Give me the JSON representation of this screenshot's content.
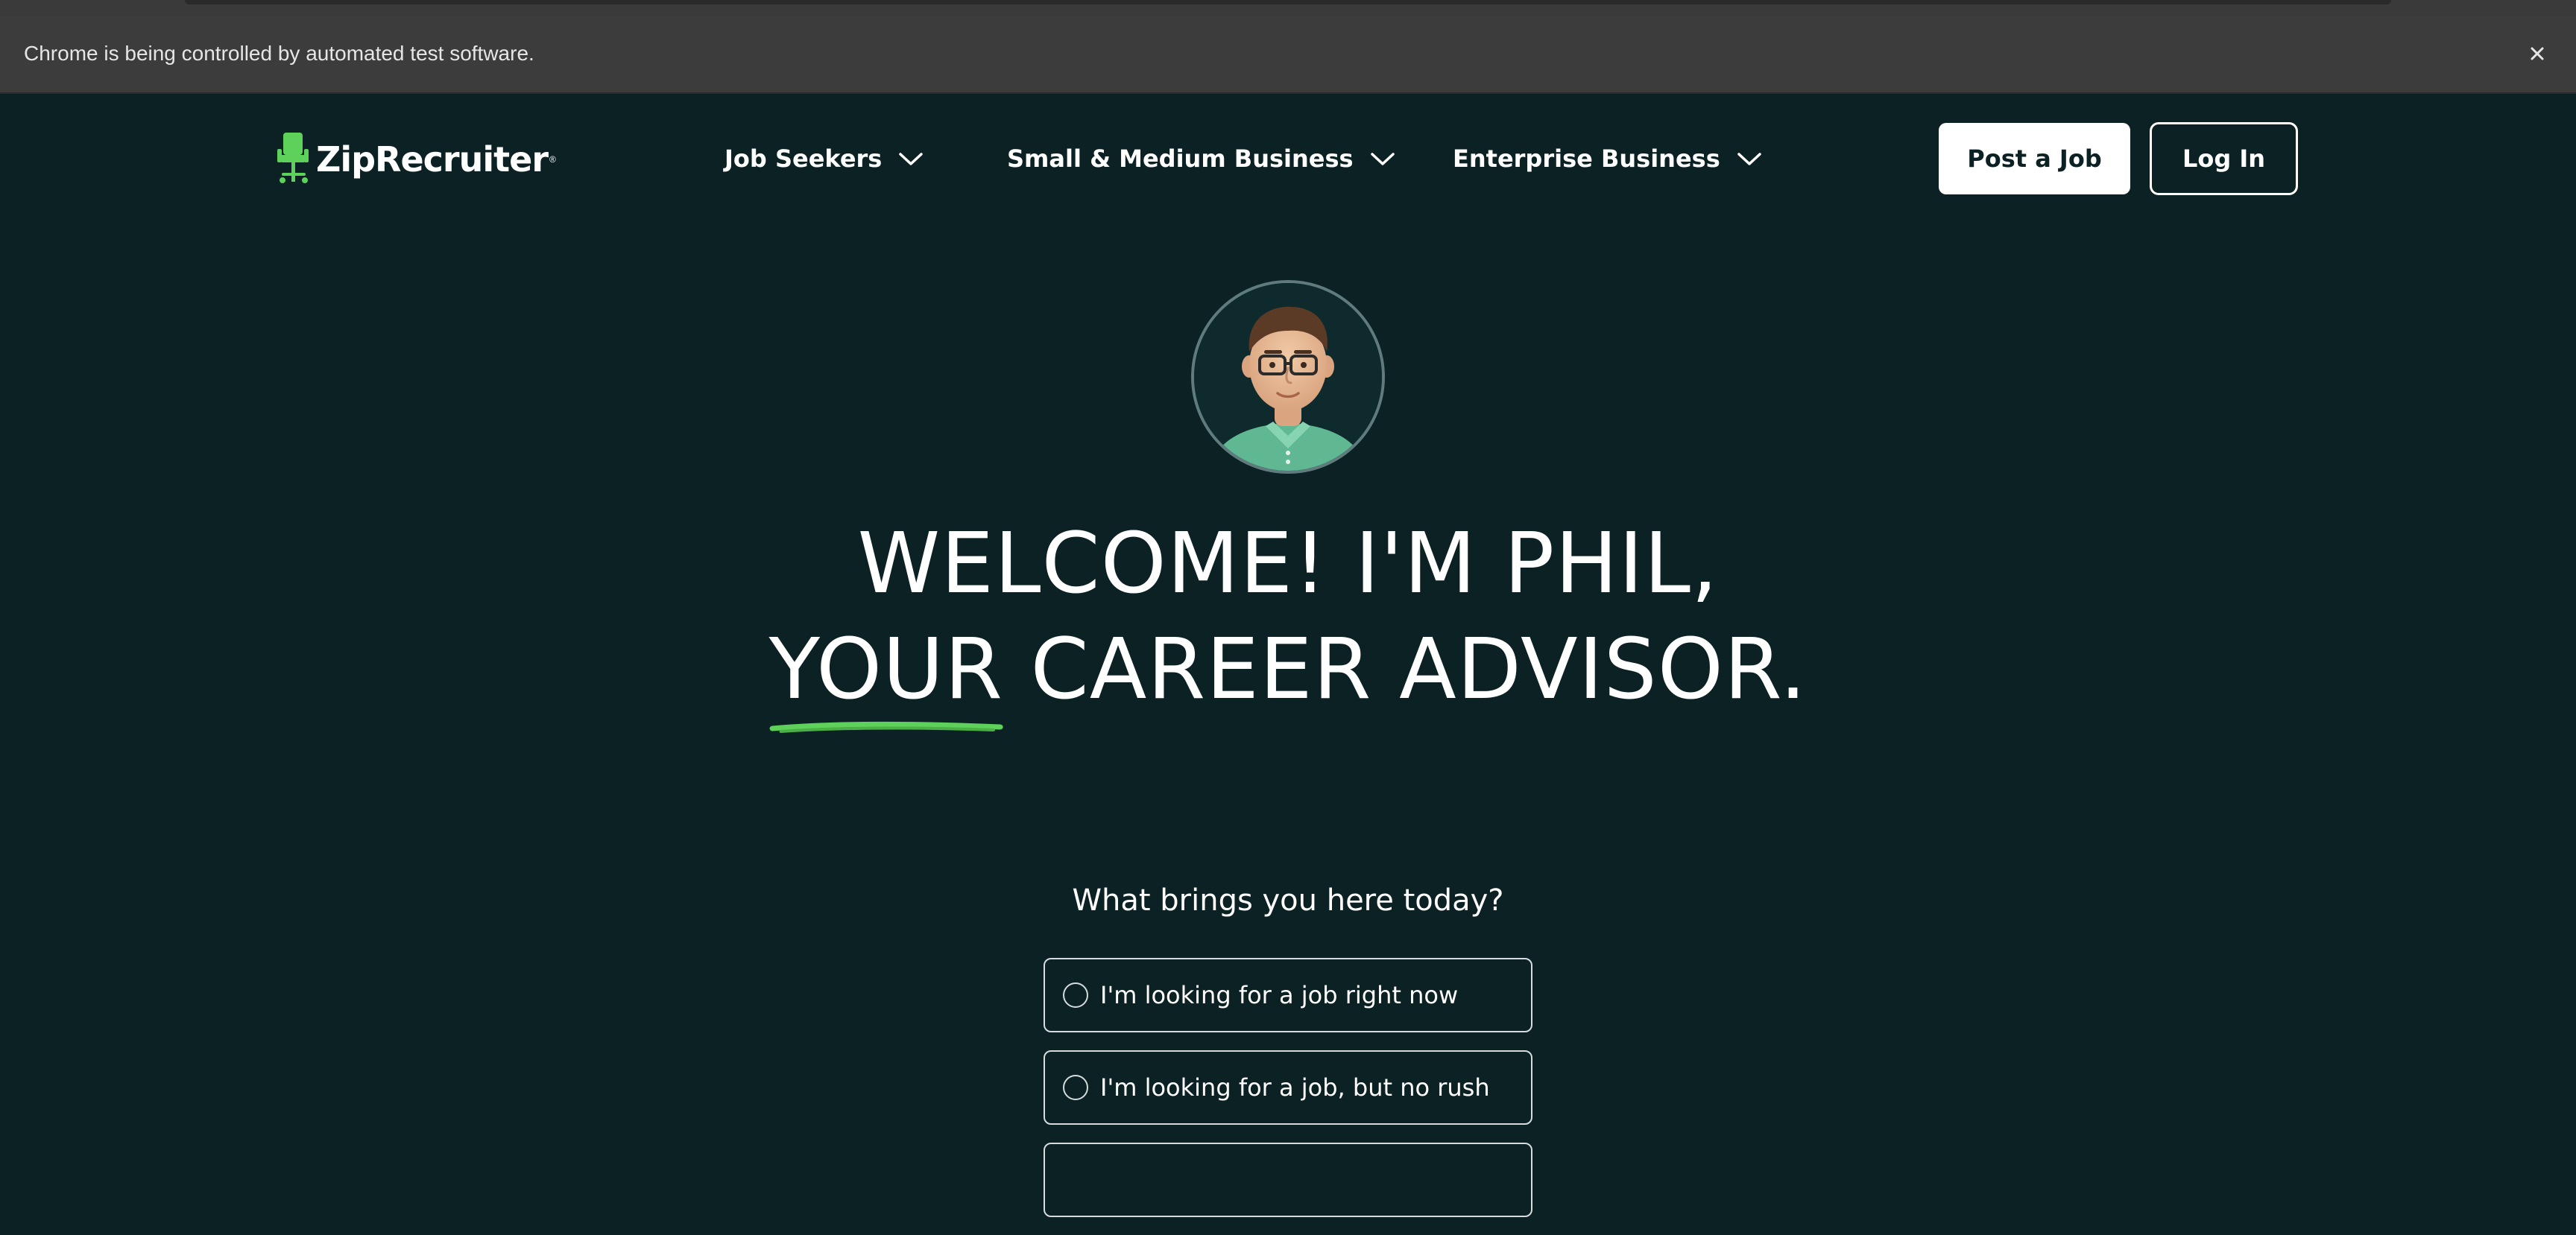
{
  "browser": {
    "infobar_text": "Chrome is being controlled by automated test software."
  },
  "header": {
    "logo_text": "ZipRecruiter",
    "logo_mark": "®",
    "nav": [
      {
        "label": "Job Seekers"
      },
      {
        "label": "Small & Medium Business"
      },
      {
        "label": "Enterprise Business"
      }
    ],
    "post_job_label": "Post a Job",
    "login_label": "Log In"
  },
  "hero": {
    "headline_line1": "WELCOME! I'M PHIL,",
    "headline_line2_highlight": "YOUR",
    "headline_line2_rest": " CAREER ADVISOR.",
    "question": "What brings you here today?",
    "options": [
      {
        "label": "I'm looking for a job right now"
      },
      {
        "label": "I'm looking for a job, but no rush"
      }
    ]
  },
  "colors": {
    "background": "#0b2124",
    "brand_green": "#5ed15a",
    "text": "#ffffff"
  },
  "icons": {
    "logo": "chair-icon",
    "nav_chevron": "chevron-down-icon",
    "infobar_close": "close-icon"
  }
}
